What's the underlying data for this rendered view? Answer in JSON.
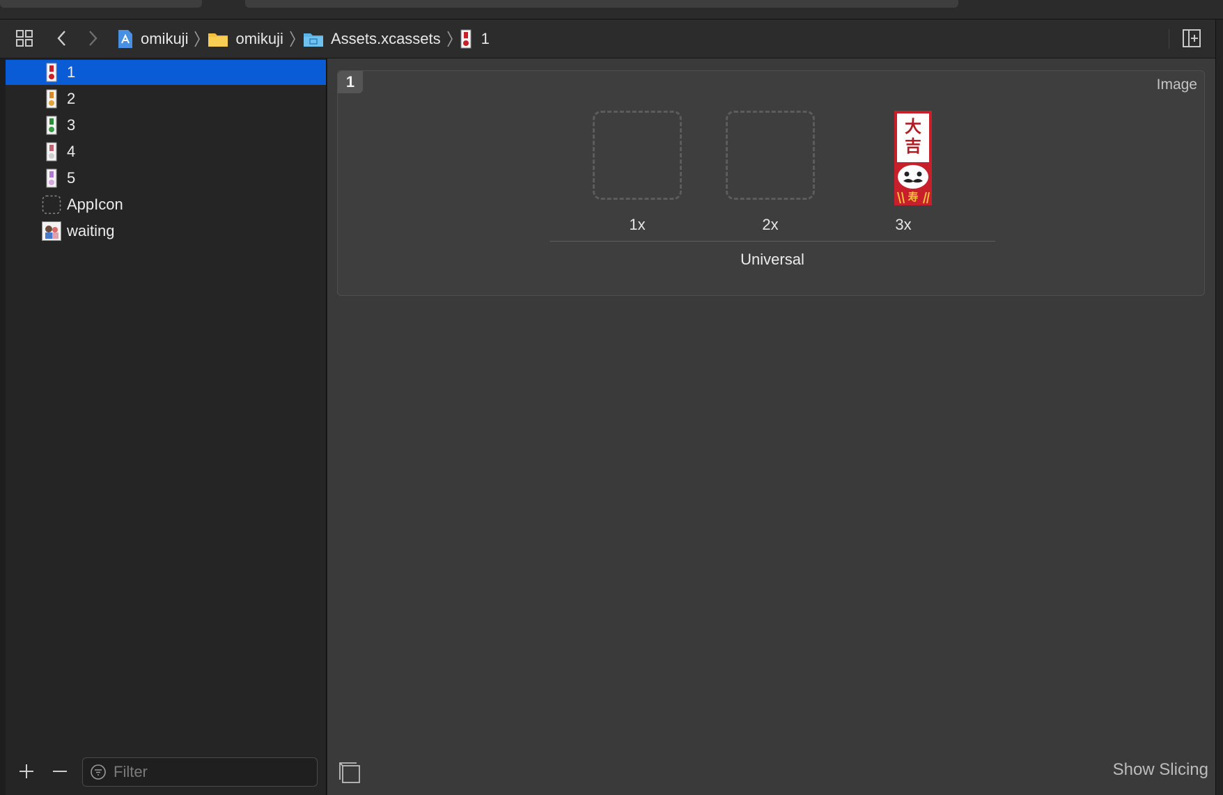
{
  "jumpbar": {
    "crumbs": [
      {
        "label": "omikuji",
        "icon": "project-icon"
      },
      {
        "label": "omikuji",
        "icon": "folder-icon"
      },
      {
        "label": "Assets.xcassets",
        "icon": "asset-catalog-icon"
      },
      {
        "label": "1",
        "icon": "image-set-icon"
      }
    ]
  },
  "sidebar": {
    "items": [
      {
        "label": "1",
        "selected": true
      },
      {
        "label": "2"
      },
      {
        "label": "3"
      },
      {
        "label": "4"
      },
      {
        "label": "5"
      },
      {
        "label": "AppIcon"
      },
      {
        "label": "waiting"
      }
    ],
    "filter_placeholder": "Filter"
  },
  "editor": {
    "badge": "1",
    "type_label": "Image",
    "slots": [
      "1x",
      "2x",
      "3x"
    ],
    "group_label": "Universal",
    "show_slicing": "Show Slicing",
    "omikuji_glyphs": [
      "大",
      "吉"
    ],
    "omikuji_bottom": "寿"
  },
  "colors": {
    "selection": "#0a5bd6",
    "omikuji_red": "#c8202a"
  }
}
